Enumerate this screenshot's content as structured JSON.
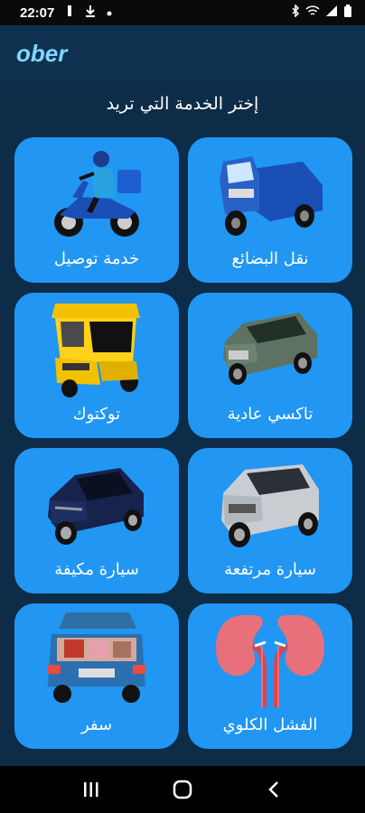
{
  "status_bar": {
    "time": "22:07",
    "icons": [
      "signal-1-icon",
      "download-icon",
      "dot-icon",
      "bluetooth-icon",
      "wifi-icon",
      "cell-signal-icon",
      "battery-icon"
    ]
  },
  "app_bar": {
    "title": "ober"
  },
  "heading": "إختر الخدمة التي تريد",
  "services": [
    {
      "label": "خدمة توصيل",
      "icon": "delivery-scooter-icon"
    },
    {
      "label": "نقل البضائع",
      "icon": "cargo-tricycle-icon"
    },
    {
      "label": "توكتوك",
      "icon": "tuktuk-icon"
    },
    {
      "label": "تاكسي عادية",
      "icon": "sedan-car-icon"
    },
    {
      "label": "سيارة مكيفة",
      "icon": "air-conditioned-car-icon"
    },
    {
      "label": "سيارة مرتفعة",
      "icon": "suv-car-icon"
    },
    {
      "label": "سفر",
      "icon": "travel-car-icon"
    },
    {
      "label": "الفشل الكلوي",
      "icon": "kidneys-icon"
    }
  ],
  "nav_bar": {
    "icons": [
      "recents-icon",
      "home-icon",
      "back-icon"
    ]
  },
  "colors": {
    "background": "#0d2c47",
    "card": "#2196f3",
    "logo": "#7fd7ff"
  }
}
